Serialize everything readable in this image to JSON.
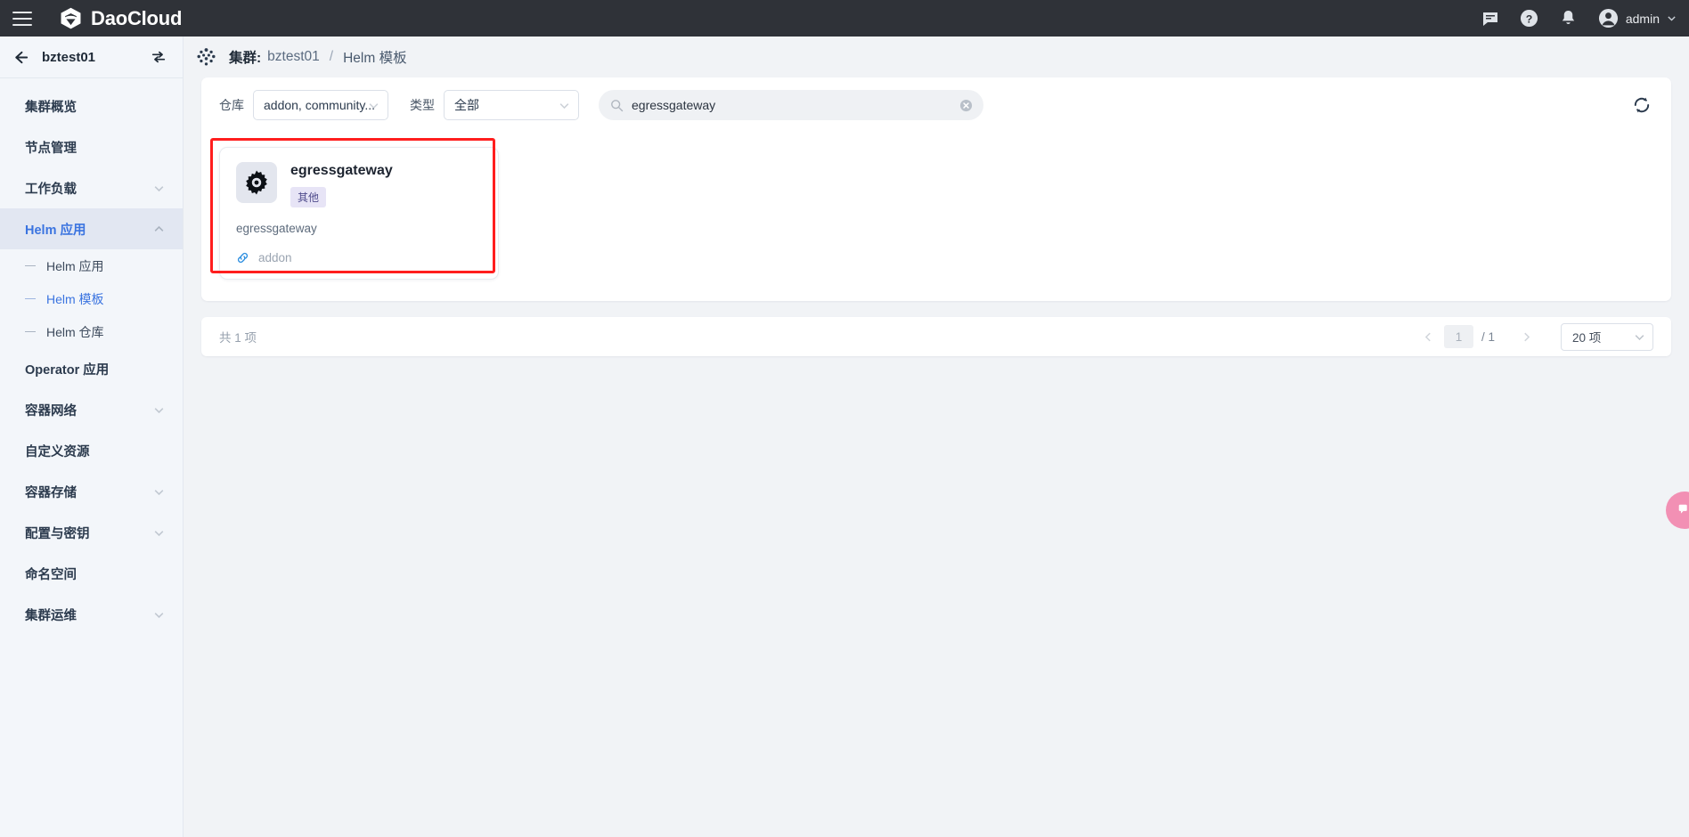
{
  "topbar": {
    "brand": "DaoCloud",
    "menu_icon": "hamburger-icon",
    "icons": [
      "chat-icon",
      "help-icon",
      "bell-icon"
    ],
    "user": "admin",
    "bg_color": "#2f3238"
  },
  "sidebar": {
    "cluster": "bztest01",
    "items": [
      {
        "label": "集群概览",
        "type": "item",
        "active": false,
        "expandable": false
      },
      {
        "label": "节点管理",
        "type": "item",
        "active": false,
        "expandable": false
      },
      {
        "label": "工作负载",
        "type": "item",
        "active": false,
        "expandable": true
      },
      {
        "label": "Helm 应用",
        "type": "item",
        "active": true,
        "expandable": true
      },
      {
        "label": "Helm 应用",
        "type": "sub",
        "selected": false
      },
      {
        "label": "Helm 模板",
        "type": "sub",
        "selected": true
      },
      {
        "label": "Helm 仓库",
        "type": "sub",
        "selected": false
      },
      {
        "label": "Operator 应用",
        "type": "item",
        "active": false,
        "expandable": false
      },
      {
        "label": "容器网络",
        "type": "item",
        "active": false,
        "expandable": true
      },
      {
        "label": "自定义资源",
        "type": "item",
        "active": false,
        "expandable": false
      },
      {
        "label": "容器存储",
        "type": "item",
        "active": false,
        "expandable": true
      },
      {
        "label": "配置与密钥",
        "type": "item",
        "active": false,
        "expandable": true
      },
      {
        "label": "命名空间",
        "type": "item",
        "active": false,
        "expandable": false
      },
      {
        "label": "集群运维",
        "type": "item",
        "active": false,
        "expandable": true
      }
    ],
    "accent_color": "#3b74e0",
    "active_bg": "#e2e7f2"
  },
  "breadcrumb": {
    "prefix": "集群:",
    "cluster": "bztest01",
    "separator": "/",
    "current": "Helm 模板"
  },
  "filters": {
    "repo_label": "仓库",
    "repo_value": "addon, community...",
    "type_label": "类型",
    "type_value": "全部",
    "search_value": "egressgateway",
    "search_placeholder": "",
    "refresh_icon": "refresh-icon"
  },
  "cards": [
    {
      "title": "egressgateway",
      "tag": "其他",
      "description": "egressgateway",
      "repo": "addon",
      "logo_icon": "gear-icon",
      "link_icon": "link-icon",
      "highlight_color": "#ff1e1e"
    }
  ],
  "footer": {
    "total_text": "共 1 项",
    "page_current": "1",
    "page_of": "/ 1",
    "page_size": "20 项",
    "prev_icon": "chevron-left-icon",
    "next_icon": "chevron-right-icon"
  },
  "fab": {
    "icon": "feedback-icon",
    "color": "#f290b4"
  }
}
